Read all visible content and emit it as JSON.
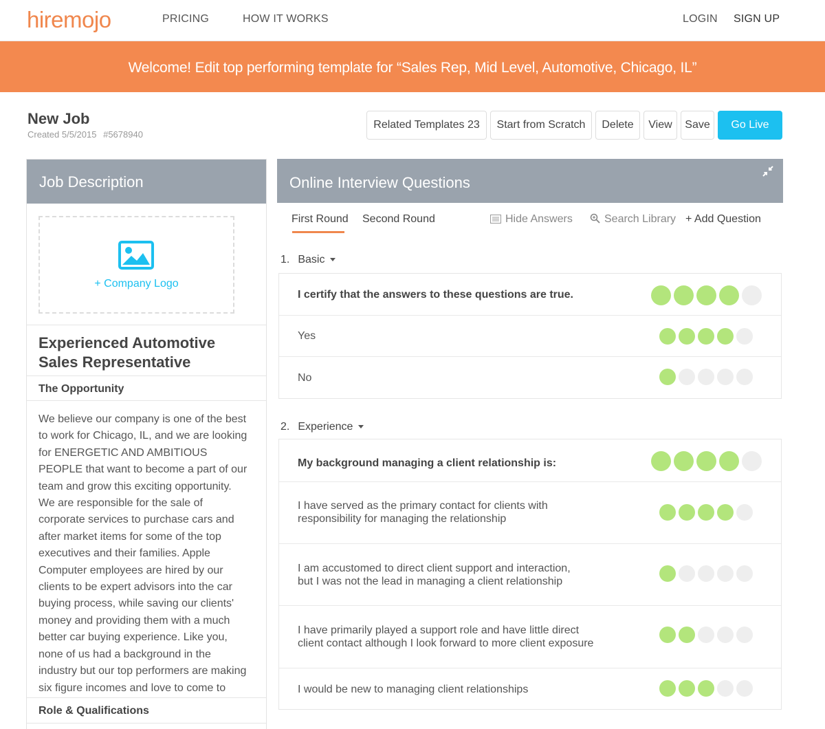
{
  "nav": {
    "logo": "hiremojo",
    "links": [
      "PRICING",
      "HOW IT WORKS"
    ],
    "login": "LOGIN",
    "signup": "SIGN UP"
  },
  "banner": {
    "text": "Welcome! Edit top performing template for “Sales Rep, Mid Level, Automotive, Chicago, IL”"
  },
  "job": {
    "title": "New Job",
    "created": "Created 5/5/2015",
    "id": "#5678940"
  },
  "actions": {
    "related": "Related Templates 23",
    "scratch": "Start from Scratch",
    "delete": "Delete",
    "view": "View",
    "save": "Save",
    "golive": "Go Live"
  },
  "job_description": {
    "header": "Job Description",
    "logo_link": "+  Company Logo",
    "heading": "Experienced Automotive Sales Representative",
    "section1": "The Opportunity",
    "body": "We believe our company is one of the best to work for Chicago, IL, and we are looking for ENERGETIC AND AMBITIOUS PEOPLE that want to become a part of our team and grow this exciting opportunity. We are responsible for the sale of corporate services to purchase cars and after market items for some of the top executives and their families. Apple Computer employees are hired by our clients to be expert advisors into the car buying process, while saving our clients' money and providing them with a much better car buying experience. Like you, none of us had a background in the industry but our top performers are making six figure incomes and love to come to work every day. Our",
    "section2": "Role & Qualifications"
  },
  "interview": {
    "header": "Online Interview Questions",
    "tabs": [
      "First Round",
      "Second Round"
    ],
    "hide_answers": "Hide Answers",
    "search_library": "Search Library",
    "add_question": "+ Add Question",
    "accent": "#f0874d",
    "rating_on_color": "#b3e57c",
    "rating_off_color": "#eeeeee",
    "questions": [
      {
        "number": "1.",
        "category": "Basic",
        "prompt": "I certify that the answers to these questions are true.",
        "prompt_rating": 4,
        "answers": [
          {
            "text": "Yes",
            "rating": 4
          },
          {
            "text": "No",
            "rating": 1
          }
        ]
      },
      {
        "number": "2.",
        "category": "Experience",
        "prompt": "My background managing a client relationship is:",
        "prompt_rating": 4,
        "answers": [
          {
            "text": "I have served as the primary contact for clients with responsibility for managing the relationship",
            "rating": 4
          },
          {
            "text": "I am accustomed to direct client support and interaction, but I was not the lead in managing a client relationship",
            "rating": 1
          },
          {
            "text": "I have primarily played a support role and have little direct client contact although I look forward to more client exposure",
            "rating": 2
          },
          {
            "text": "I would be new to managing client relationships",
            "rating": 3
          }
        ]
      }
    ]
  }
}
